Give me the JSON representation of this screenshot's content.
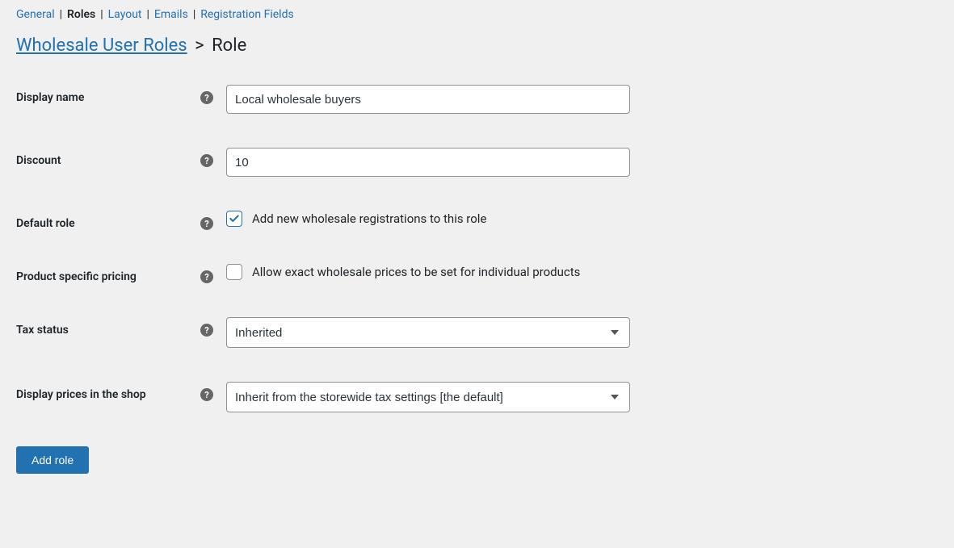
{
  "nav": {
    "tabs": [
      {
        "label": "General",
        "active": false
      },
      {
        "label": "Roles",
        "active": true
      },
      {
        "label": "Layout",
        "active": false
      },
      {
        "label": "Emails",
        "active": false
      },
      {
        "label": "Registration Fields",
        "active": false
      }
    ]
  },
  "breadcrumb": {
    "parent": "Wholesale User Roles",
    "current": "Role"
  },
  "form": {
    "display_name": {
      "label": "Display name",
      "value": "Local wholesale buyers"
    },
    "discount": {
      "label": "Discount",
      "value": "10"
    },
    "default_role": {
      "label": "Default role",
      "checkbox_label": "Add new wholesale registrations to this role",
      "checked": true
    },
    "product_pricing": {
      "label": "Product specific pricing",
      "checkbox_label": "Allow exact wholesale prices to be set for individual products",
      "checked": false
    },
    "tax_status": {
      "label": "Tax status",
      "value": "Inherited"
    },
    "display_prices": {
      "label": "Display prices in the shop",
      "value": "Inherit from the storewide tax settings [the default]"
    }
  },
  "buttons": {
    "submit": "Add role"
  }
}
